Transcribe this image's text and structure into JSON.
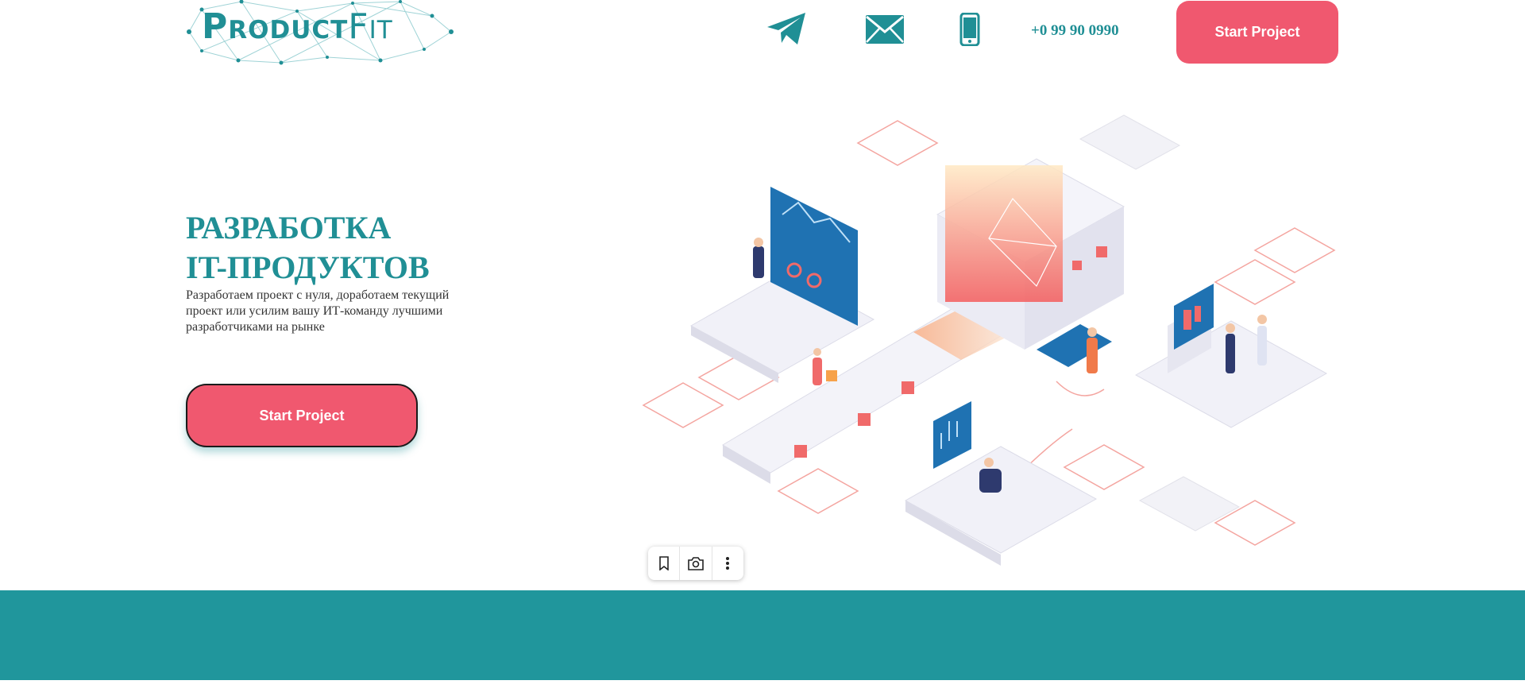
{
  "header": {
    "logo": {
      "text_main": "Product",
      "text_fit": "Fit"
    },
    "icons": [
      "telegram-icon",
      "mail-icon",
      "phone-icon"
    ],
    "phone": "+0 99 90 0990",
    "cta_label": "Start Project"
  },
  "hero": {
    "title_line1": "Разработка",
    "title_line2": "IT-продуктов",
    "description": "Разработаем проект с нуля, доработаем текущий проект или усилим вашу ИТ-команду лучшими разработчиками на рынке",
    "cta_label": "Start Project"
  },
  "toolbar": {
    "icons": [
      "bookmark-icon",
      "camera-search-icon",
      "more-vertical-icon"
    ]
  },
  "colors": {
    "brand_teal": "#208f95",
    "band_teal": "#20969c",
    "accent_pink": "#f0586f"
  }
}
